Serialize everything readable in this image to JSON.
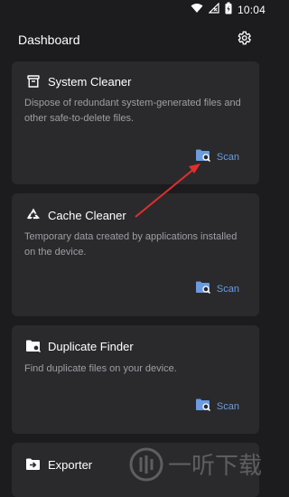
{
  "status_bar": {
    "time": "10:04",
    "icons": [
      "wifi-icon",
      "signal-off-icon",
      "battery-charging-icon"
    ]
  },
  "header": {
    "title": "Dashboard",
    "settings_icon": "gear-icon"
  },
  "cards": [
    {
      "title": "System Cleaner",
      "icon": "trash-bin-icon",
      "description": "Dispose of redundant system-generated files and other safe-to-delete files.",
      "action": "Scan"
    },
    {
      "title": "Cache Cleaner",
      "icon": "recycle-icon",
      "description": "Temporary data created by applications installed on the device.",
      "action": "Scan"
    },
    {
      "title": "Duplicate Finder",
      "icon": "folder-search-icon",
      "description": "Find duplicate files on your device.",
      "action": "Scan"
    },
    {
      "title": "Exporter",
      "icon": "folder-export-icon"
    }
  ],
  "colors": {
    "background": "#1c1c1e",
    "card": "#2a2a2d",
    "accent": "#6b9bde",
    "description": "#9e9ea4",
    "annotation_arrow": "#e0302a"
  },
  "watermark": {
    "text": "一听下载"
  }
}
